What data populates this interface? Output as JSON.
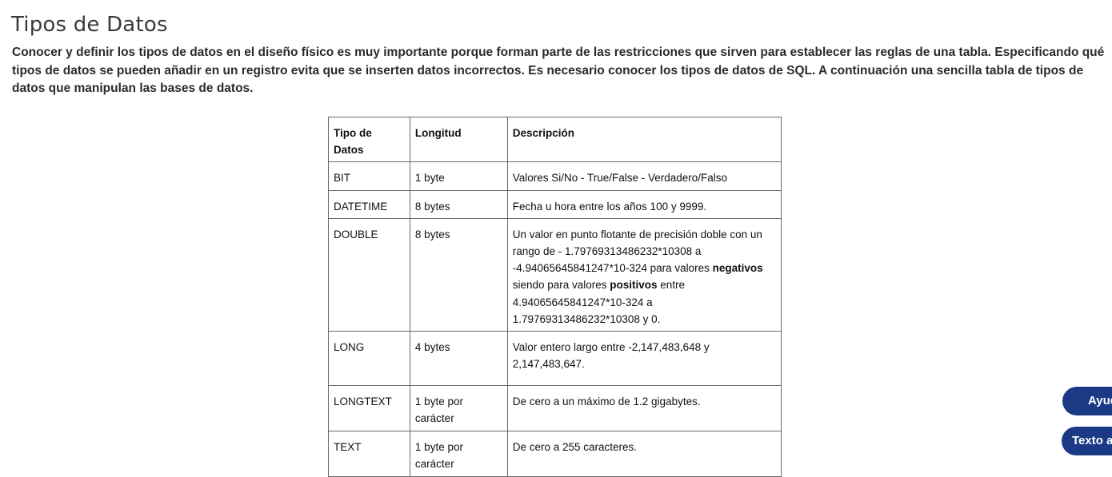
{
  "page": {
    "title": "Tipos de Datos",
    "intro": "Conocer y definir los tipos de datos en el diseño físico es muy importante porque forman parte de las restricciones que sirven para establecer las reglas de una tabla. Especificando qué tipos de datos se pueden añadir en un registro evita que se inserten datos incorrectos. Es necesario conocer los tipos de datos de SQL. A continuación una sencilla tabla de tipos de datos que manipulan las bases de datos."
  },
  "table": {
    "headers": [
      "Tipo de Datos",
      "Longitud",
      "Descripción"
    ],
    "rows": [
      {
        "type": "BIT",
        "length": "1 byte",
        "description": "Valores Si/No - True/False - Verdadero/Falso"
      },
      {
        "type": "DATETIME",
        "length": "8 bytes",
        "description": "Fecha u hora entre los años 100 y 9999."
      },
      {
        "type": "DOUBLE",
        "length": "8 bytes",
        "description_parts": [
          "Un valor en punto flotante de precisión doble  con un rango de - 1.79769313486232*10308 a -4.94065645841247*10-324 para valores ",
          "negativos",
          " siendo para valores ",
          "positivos",
          " entre 4.94065645841247*10-324 a 1.79769313486232*10308 y 0."
        ]
      },
      {
        "type": "LONG",
        "length": "4 bytes",
        "description": "Valor entero largo entre -2,147,483,648 y 2,147,483,647."
      },
      {
        "type": "LONGTEXT",
        "length": "1 byte por carácter",
        "description": "De cero a un máximo de 1.2 gigabytes."
      },
      {
        "type": "TEXT",
        "length": "1 byte por carácter",
        "description": "De cero a 255 caracteres."
      }
    ]
  },
  "floating_buttons": {
    "ayuda_label": "Ayuda",
    "texto_label": "Texto a"
  },
  "colors": {
    "button_bg": "#1b3a86",
    "table_border": "#6a6a6a",
    "title_text": "#3a3a3a"
  }
}
